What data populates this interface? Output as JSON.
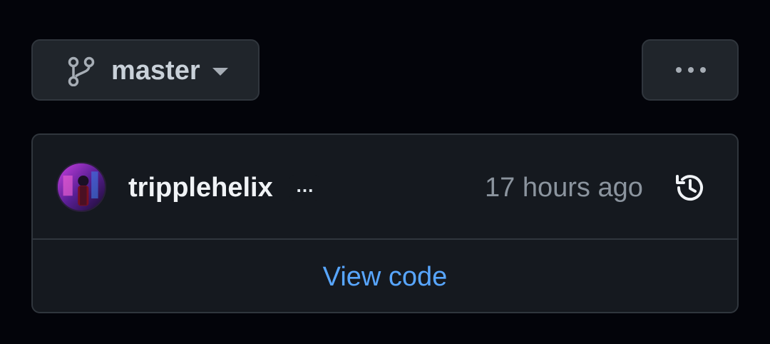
{
  "branch": {
    "label": "master",
    "icon": "git-branch-icon",
    "caret_icon": "caret-down-icon"
  },
  "more_button": {
    "icon": "kebab-horizontal-icon"
  },
  "commit": {
    "author": "tripplehelix",
    "ellipsis": "…",
    "time": "17 hours ago",
    "history_icon": "history-icon"
  },
  "view_code": {
    "label": "View code"
  },
  "colors": {
    "background": "#03040a",
    "button_bg": "#20252b",
    "card_bg": "#15191f",
    "border": "#30363d",
    "text_primary": "#f0f3f6",
    "text_muted": "#8b949e",
    "link": "#58a6ff"
  }
}
